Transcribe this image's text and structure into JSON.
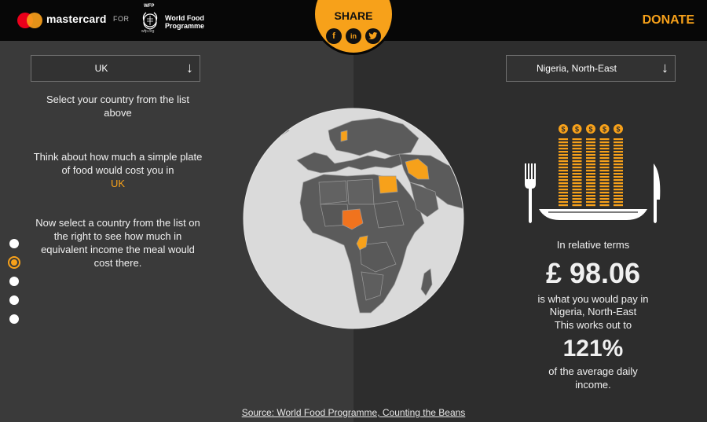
{
  "header": {
    "brand": "mastercard",
    "connector": "FOR",
    "partner_abbr": "WFP",
    "partner_name": "World Food Programme",
    "partner_url": "wfp.org",
    "donate_label": "DONATE"
  },
  "share": {
    "label": "SHARE",
    "icons": [
      "facebook-icon",
      "linkedin-icon",
      "twitter-icon"
    ]
  },
  "left": {
    "country_select": {
      "value": "UK"
    },
    "instruction_select": "Select your country from the list above",
    "instruction_think": "Think about how much a simple plate of food would cost you in",
    "selected_country": "UK",
    "instruction_compare": "Now select a country from the list on the right to see how much in equivalent income the meal would cost there."
  },
  "right": {
    "country_select": {
      "value": "Nigeria, North-East"
    },
    "relative_label": "In relative terms",
    "price": "£ 98.06",
    "pay_label": "is what you would pay in",
    "selected_region": "Nigeria, North-East",
    "works_label": "This works out to",
    "percent": "121%",
    "percent_label": "of the average daily income."
  },
  "nav": {
    "count": 5,
    "active_index": 1
  },
  "map": {
    "highlighted": [
      "UK",
      "Egypt",
      "Iran",
      "Nigeria",
      "Congo"
    ],
    "highlight_color": "#f7a11a",
    "selected_color": "#f0731e"
  },
  "source": "Source: World Food Programme, Counting the Beans",
  "colors": {
    "accent": "#f7a11a",
    "background": "#3a3a3a",
    "panel": "#2d2d2d",
    "topbar": "#070707"
  }
}
